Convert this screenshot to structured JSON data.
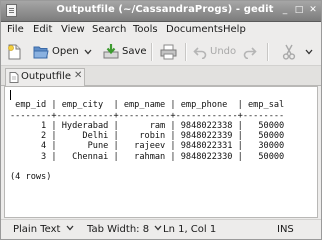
{
  "window": {
    "title": "Outputfile (~/CassandraProgs) - gedit",
    "minimize_glyph": "_",
    "maximize_glyph": "□",
    "close_glyph": "✕"
  },
  "menu": [
    "File",
    "Edit",
    "View",
    "Search",
    "Tools",
    "Documents",
    "Help"
  ],
  "toolbar": {
    "open_label": "Open",
    "save_label": "Save",
    "undo_label": "Undo"
  },
  "tab": {
    "label": "Outputfile",
    "close_glyph": "✕"
  },
  "document": {
    "lines": [
      "",
      " emp_id | emp_city  | emp_name | emp_phone  | emp_sal",
      "--------+-----------+----------+------------+--------",
      "      1 | Hyderabad |      ram | 9848022338 |   50000",
      "      2 |     Delhi |    robin | 9848022339 |   50000",
      "      4 |      Pune |   rajeev | 9848022331 |   30000",
      "      3 |   Chennai |   rahman | 9848022330 |   50000",
      "",
      "(4 rows)"
    ]
  },
  "status": {
    "language": "Plain Text",
    "tab_width": "Tab Width: 8",
    "position": "Ln 1, Col 1",
    "mode": "INS"
  },
  "icons": {
    "new": "new-document-icon",
    "open": "open-folder-icon",
    "save": "save-icon",
    "print": "print-icon",
    "undo": "undo-icon",
    "redo": "redo-icon",
    "cut": "cut-icon"
  }
}
